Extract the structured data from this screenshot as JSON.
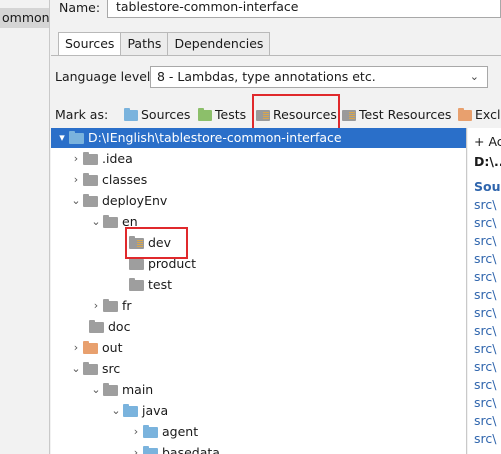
{
  "sidebar": {
    "selected_item": "ommon-int"
  },
  "module": {
    "name_label": "Name:",
    "name_value": "tablestore-common-interface"
  },
  "tabs": [
    "Sources",
    "Paths",
    "Dependencies"
  ],
  "language_level": {
    "label": "Language level:",
    "value": "8 - Lambdas, type annotations etc."
  },
  "mark_as": {
    "label": "Mark as:",
    "items": [
      "Sources",
      "Tests",
      "Resources",
      "Test Resources",
      "Exclu"
    ]
  },
  "tree": {
    "root": "D:\\IEnglish\\tablestore-common-interface",
    "nodes": [
      ".idea",
      "classes",
      "deployEnv",
      "en",
      "dev",
      "product",
      "test",
      "fr",
      "doc",
      "out",
      "src",
      "main",
      "java",
      "agent",
      "basedata"
    ]
  },
  "right_pane": {
    "add_label": "+ Ac",
    "path": "D:\\...",
    "source_header": "Sour",
    "entries": [
      "src\\",
      "src\\",
      "src\\",
      "src\\",
      "src\\",
      "src\\",
      "src\\",
      "src\\",
      "src\\",
      "src\\",
      "src\\",
      "src\\",
      "src\\",
      "src\\"
    ]
  },
  "colors": {
    "selection": "#2a6fc9",
    "highlight": "#e0292c",
    "source_blue": "#7ab3dd",
    "excluded_orange": "#e8a06e"
  }
}
